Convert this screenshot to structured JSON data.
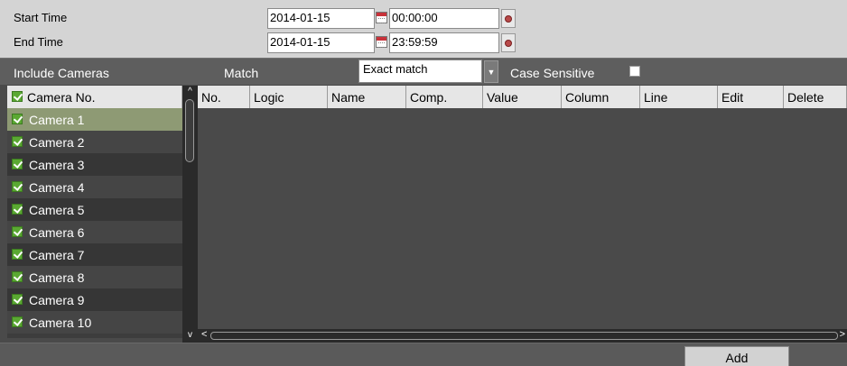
{
  "time": {
    "start_label": "Start Time",
    "start_date": "2014-01-15",
    "start_time": "00:00:00",
    "end_label": "End Time",
    "end_date": "2014-01-15",
    "end_time": "23:59:59"
  },
  "filter": {
    "include_label": "Include Cameras",
    "match_label": "Match",
    "match_value": "Exact match",
    "case_label": "Case Sensitive",
    "case_checked": false
  },
  "cameras": {
    "header": "Camera No.",
    "selected_index": 0,
    "items": [
      {
        "label": "Camera 1",
        "checked": true
      },
      {
        "label": "Camera 2",
        "checked": true
      },
      {
        "label": "Camera 3",
        "checked": true
      },
      {
        "label": "Camera 4",
        "checked": true
      },
      {
        "label": "Camera 5",
        "checked": true
      },
      {
        "label": "Camera 6",
        "checked": true
      },
      {
        "label": "Camera 7",
        "checked": true
      },
      {
        "label": "Camera 8",
        "checked": true
      },
      {
        "label": "Camera 9",
        "checked": true
      },
      {
        "label": "Camera 10",
        "checked": true
      }
    ]
  },
  "rules": {
    "columns": [
      "No.",
      "Logic",
      "Name",
      "Comp.",
      "Value",
      "Column",
      "Line",
      "Edit",
      "Delete"
    ]
  },
  "actions": {
    "add_label": "Add"
  },
  "colors": {
    "selected_row": "#8e9a74",
    "checkbox": "#5aa832",
    "panel": "#d4d4d4"
  }
}
